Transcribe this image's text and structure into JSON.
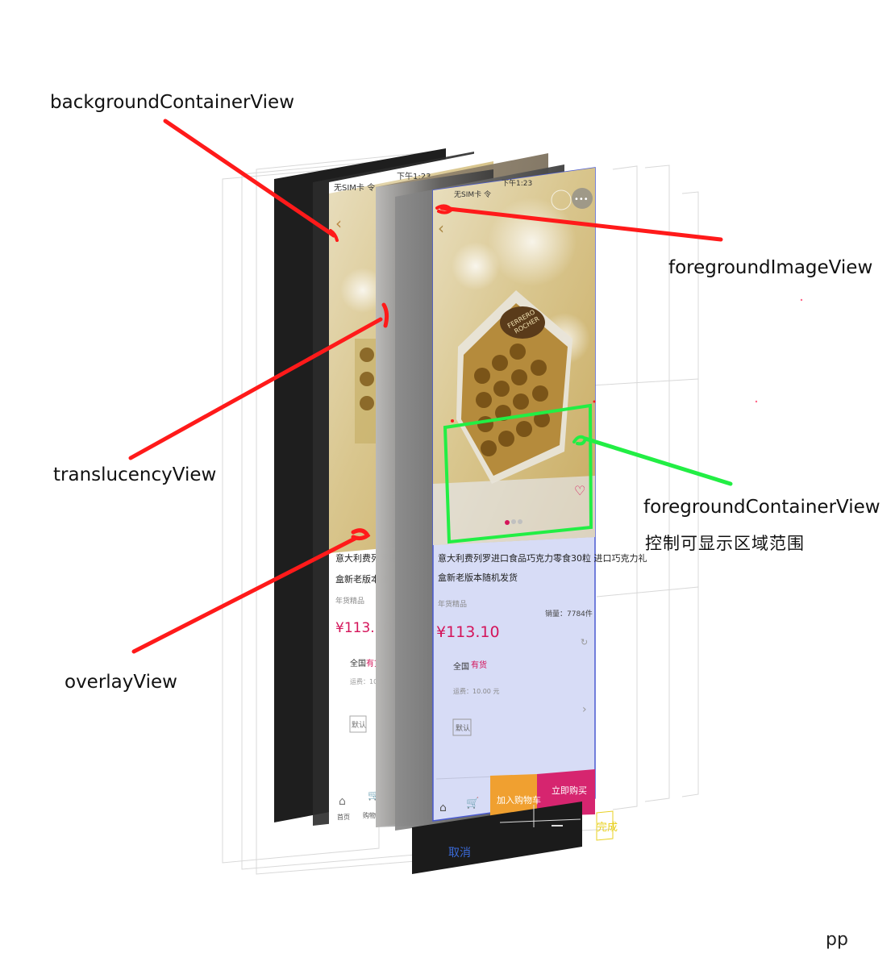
{
  "annotations": {
    "background_container": "backgroundContainerView",
    "foreground_image": "foregroundImageView",
    "translucency": "translucencyView",
    "foreground_container": "foregroundContainerView",
    "foreground_container_note": "控制可显示区域范围",
    "overlay": "overlayView"
  },
  "footer_text": "pp",
  "screens": {
    "status_bar_left": "无SIM卡 令",
    "status_bar_time": "下午1:23",
    "product_title_line1": "意大利费列罗进口食品巧克力零食30粒 进口巧克力礼",
    "product_title_line2": "盒新老版本随机发货",
    "product_title_back_line1": "意大利费列罗进",
    "product_title_back_line2": "盒新老版本随",
    "product_subtitle": "年货精品",
    "sales_count": "销量：7784件",
    "price": "¥113.10",
    "region": "全国",
    "stock": "有货",
    "shipping": "运费：10.00 元",
    "shipping_back": "运费：10.00",
    "option_default": "默认",
    "bottom_home": "首页",
    "bottom_cart": "购物车",
    "add_to_cart": "加入购物车",
    "buy_now": "立即购买",
    "cancel": "取消",
    "done": "完成",
    "box_brand_1": "FERRERO",
    "box_brand_2": "ROCHER"
  },
  "colors": {
    "arrow_red": "#ff1a1a",
    "arrow_green": "#22ee44",
    "price_pink": "#d4145a",
    "buy_pink": "#d6256f",
    "cart_orange": "#f0a030",
    "screen_tint": "#d7dcf6",
    "done_yellow": "#e8d020"
  }
}
